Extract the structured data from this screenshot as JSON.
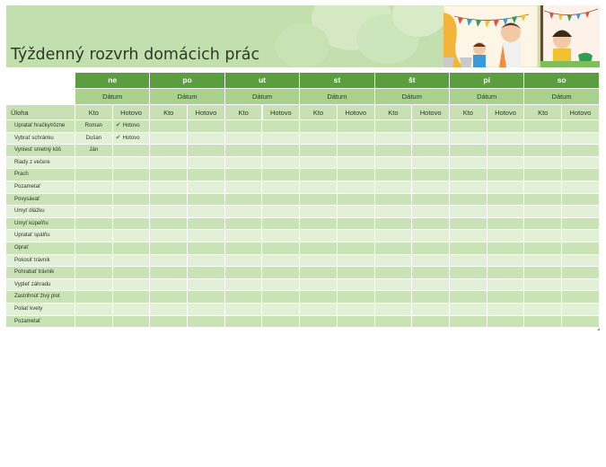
{
  "title": "Týždenný rozvrh domácich prác",
  "days": [
    "ne",
    "po",
    "ut",
    "st",
    "št",
    "pi",
    "so"
  ],
  "date_label": "Dátum",
  "task_header": "Úloha",
  "who_header": "Kto",
  "done_header": "Hotovo",
  "tasks": [
    {
      "name": "Upratať hračky/rôzne",
      "who": "Roman",
      "done": "Hotovo"
    },
    {
      "name": "Vybrať schránku",
      "who": "Dušan",
      "done": "Hotovo"
    },
    {
      "name": "Vyniesť smetný kôš",
      "who": "Ján",
      "done": ""
    },
    {
      "name": "Riady z večere",
      "who": "",
      "done": ""
    },
    {
      "name": "Prach",
      "who": "",
      "done": ""
    },
    {
      "name": "Pozametať",
      "who": "",
      "done": ""
    },
    {
      "name": "Povysávať",
      "who": "",
      "done": ""
    },
    {
      "name": "Umyť dlážku",
      "who": "",
      "done": ""
    },
    {
      "name": "Umyť kúpeľňu",
      "who": "",
      "done": ""
    },
    {
      "name": "Upratať spálňu",
      "who": "",
      "done": ""
    },
    {
      "name": "Oprať",
      "who": "",
      "done": ""
    },
    {
      "name": "Pokosiť trávnik",
      "who": "",
      "done": ""
    },
    {
      "name": "Pohrabať trávnik",
      "who": "",
      "done": ""
    },
    {
      "name": "Vypleť záhradu",
      "who": "",
      "done": ""
    },
    {
      "name": "Zastrihnúť živý plot",
      "who": "",
      "done": ""
    },
    {
      "name": "Poliať kvety",
      "who": "",
      "done": ""
    },
    {
      "name": "Pozametať",
      "who": "",
      "done": ""
    }
  ],
  "colors": {
    "header_dark": "#5a9e3f",
    "header_mid": "#a9d18e",
    "header_light": "#c8e0b4",
    "row_odd": "#c9e2b6",
    "row_even": "#e3f0d8",
    "check": "#3d8b2c"
  }
}
